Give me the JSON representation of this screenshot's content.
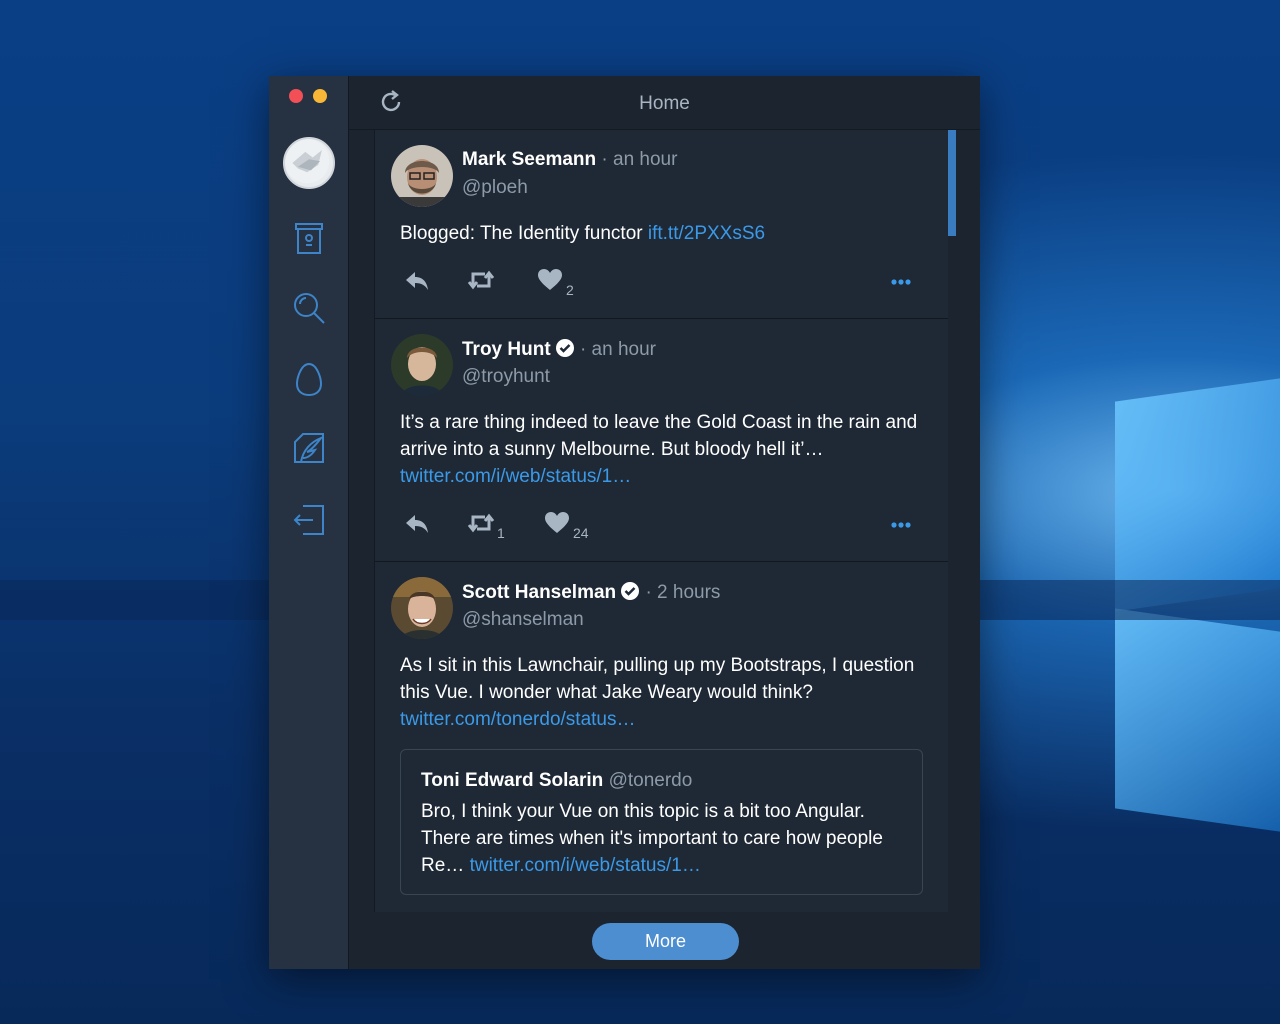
{
  "window": {
    "title": "Home"
  },
  "sidebar": {
    "items": [
      {
        "icon": "profile-avatar"
      },
      {
        "icon": "archive-icon"
      },
      {
        "icon": "search-icon"
      },
      {
        "icon": "egg-icon"
      },
      {
        "icon": "compose-icon"
      },
      {
        "icon": "logout-icon"
      }
    ]
  },
  "tweets": [
    {
      "name": "Mark Seemann",
      "time": "· an hour",
      "handle": "@ploeh",
      "text": "Blogged: The Identity functor ",
      "link": "ift.tt/2PXXsS6",
      "retweets": "",
      "likes": "2"
    },
    {
      "name": "Troy Hunt",
      "time": "· an hour",
      "handle": "@troyhunt",
      "text": "It’s a rare thing indeed to leave the Gold Coast in the rain and arrive into a sunny Melbourne. But bloody hell it’…",
      "link": "twitter.com/i/web/status/1…",
      "retweets": "1",
      "likes": "24"
    },
    {
      "name": "Scott Hanselman",
      "time": "· 2 hours",
      "handle": "@shanselman",
      "text": "As I sit in this Lawnchair, pulling up my Bootstraps, I question this Vue. I wonder what Jake Weary would think?",
      "link": "twitter.com/tonerdo/status…",
      "quote": {
        "name": "Toni Edward Solarin",
        "handle": "@tonerdo",
        "text": "Bro, I think your Vue on this topic is a bit too Angular. There are times when it's important to care how people Re… ",
        "link": "twitter.com/i/web/status/1…"
      }
    }
  ],
  "footer": {
    "more_label": "More"
  },
  "colors": {
    "accent": "#3b9ae8",
    "button": "#4d8ed1",
    "close": "#f25056",
    "minimize": "#f8b737"
  }
}
